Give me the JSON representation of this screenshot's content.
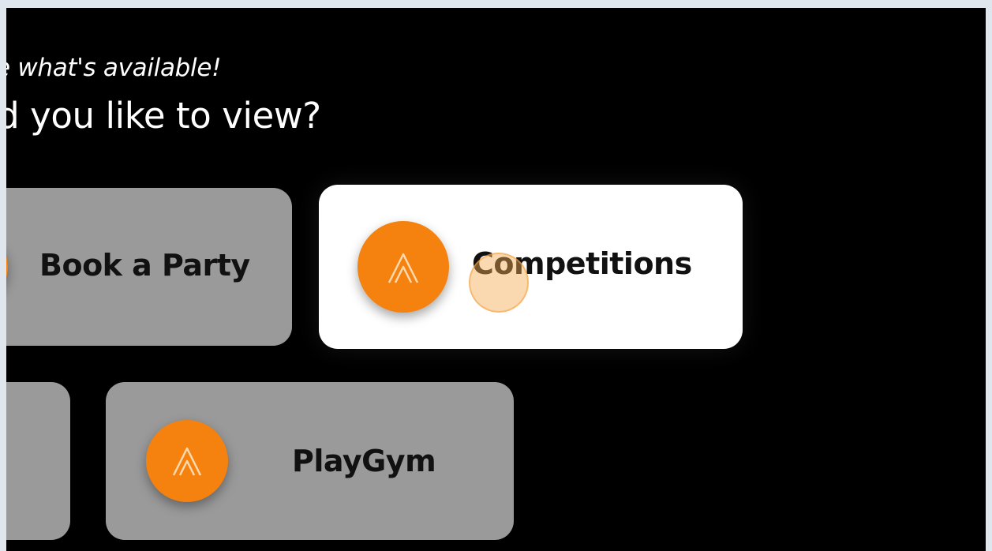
{
  "header": {
    "subtitle": "e what's available!",
    "question": "ld you like to view?"
  },
  "cards": {
    "book_party": {
      "label": "Book a Party",
      "icon": "logo-icon"
    },
    "competitions": {
      "label": "Competitions",
      "icon": "logo-icon",
      "selected": true
    },
    "playgym": {
      "label": "PlayGym",
      "icon": "logo-icon"
    }
  },
  "colors": {
    "background": "#000000",
    "card": "#9a9a9a",
    "card_selected": "#ffffff",
    "accent": "#f5820f"
  }
}
